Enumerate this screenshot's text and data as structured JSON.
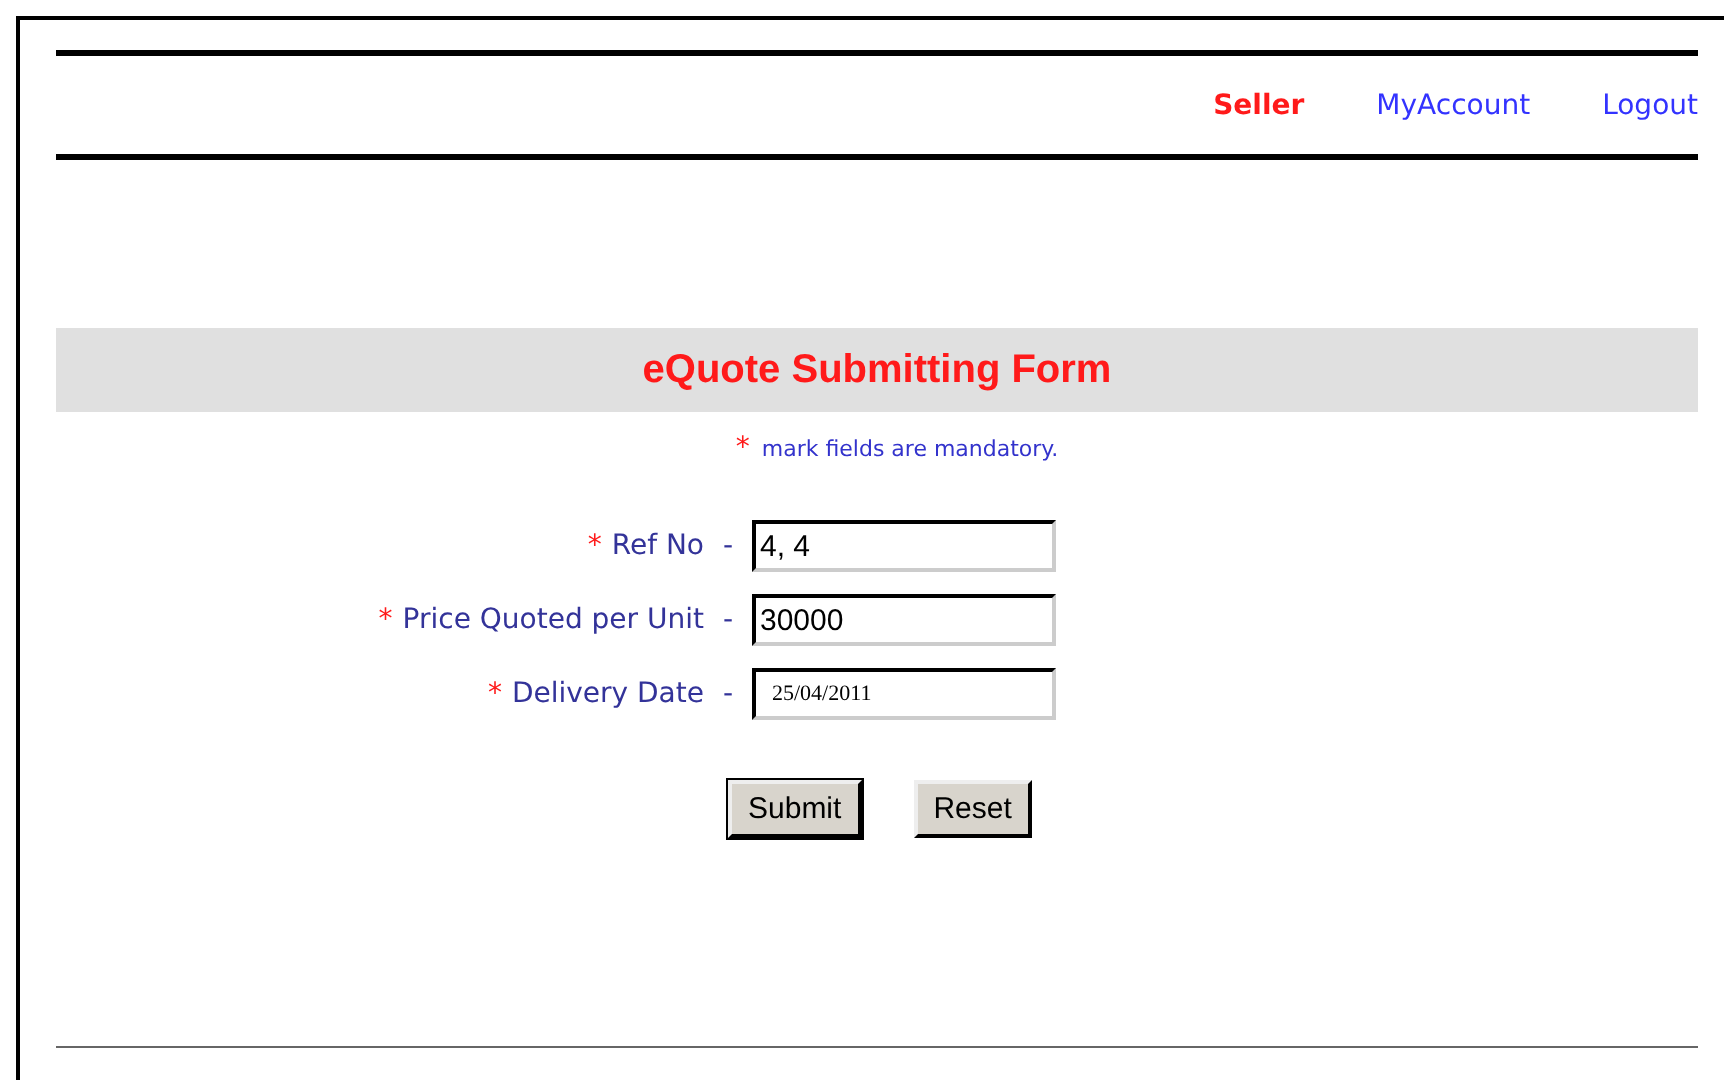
{
  "nav": [
    {
      "label": "Seller",
      "selected": true
    },
    {
      "label": "MyAccount",
      "selected": false
    },
    {
      "label": "Logout",
      "selected": false
    }
  ],
  "form": {
    "title": "eQuote Submitting Form",
    "note": {
      "marker": "*",
      "text": "mark fields are mandatory."
    },
    "fields": [
      {
        "marker": "*",
        "label": "Ref No",
        "separator": "-",
        "value": "4, 4"
      },
      {
        "marker": "*",
        "label": "Price Quoted per Unit",
        "separator": "-",
        "value": "30000"
      },
      {
        "marker": "*",
        "label": "Delivery Date",
        "separator": "-",
        "value": "25/04/2011",
        "kind": "date"
      }
    ],
    "buttons": [
      {
        "label": "Submit",
        "kind": "default"
      },
      {
        "label": "Reset",
        "kind": "plain"
      }
    ]
  }
}
